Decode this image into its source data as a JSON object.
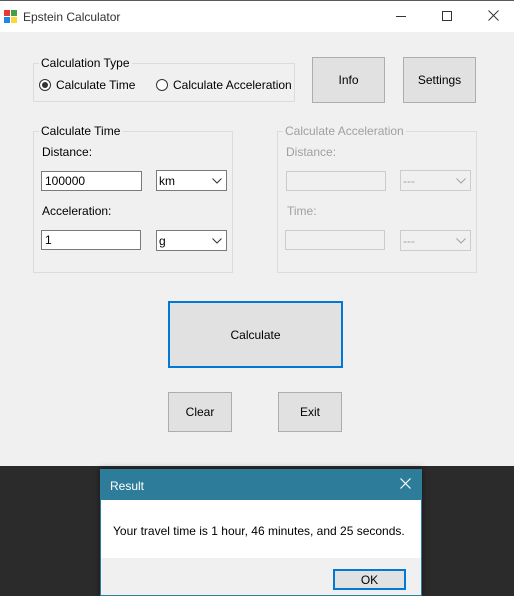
{
  "window": {
    "title": "Epstein Calculator",
    "minimize_icon": "minimize-icon",
    "maximize_icon": "maximize-icon",
    "close_icon": "close-icon"
  },
  "calc_type": {
    "legend": "Calculation Type",
    "options": [
      {
        "label": "Calculate Time",
        "checked": true
      },
      {
        "label": "Calculate Acceleration",
        "checked": false
      }
    ]
  },
  "buttons": {
    "info": "Info",
    "settings": "Settings",
    "calculate": "Calculate",
    "clear": "Clear",
    "exit": "Exit"
  },
  "calc_time": {
    "legend": "Calculate Time",
    "distance_label": "Distance:",
    "distance_value": "100000",
    "distance_unit": "km",
    "acceleration_label": "Acceleration:",
    "acceleration_value": "1",
    "acceleration_unit": "g"
  },
  "calc_accel": {
    "legend": "Calculate Acceleration",
    "distance_label": "Distance:",
    "distance_value": "",
    "distance_unit": "---",
    "time_label": "Time:",
    "time_value": "",
    "time_unit": "---"
  },
  "result_dialog": {
    "title": "Result",
    "message": "Your travel time is 1 hour, 46 minutes, and 25 seconds.",
    "ok": "OK",
    "titlebar_color": "#2d7d9a"
  },
  "colors": {
    "accent": "#0078d7",
    "window_bg": "#f0f0f0"
  }
}
